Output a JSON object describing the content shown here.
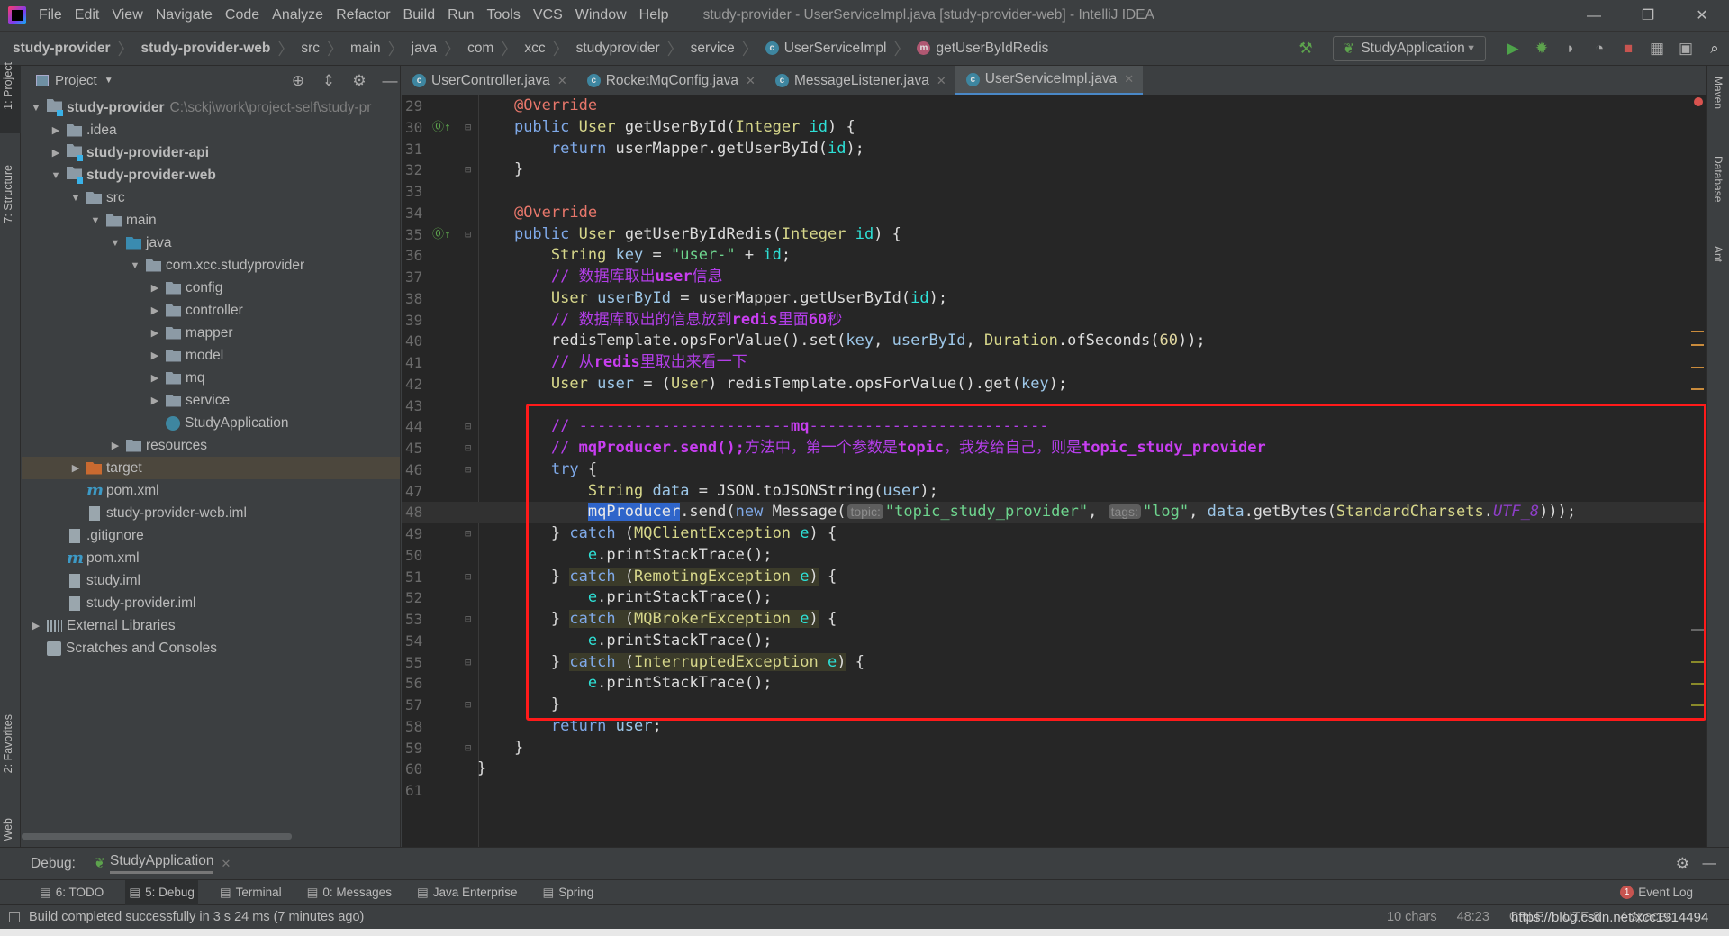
{
  "window": {
    "title": "study-provider - UserServiceImpl.java [study-provider-web] - IntelliJ IDEA",
    "menu": [
      "File",
      "Edit",
      "View",
      "Navigate",
      "Code",
      "Analyze",
      "Refactor",
      "Build",
      "Run",
      "Tools",
      "VCS",
      "Window",
      "Help"
    ],
    "controls": {
      "minimize": "—",
      "restore": "❐",
      "close": "✕"
    }
  },
  "breadcrumb": [
    {
      "label": "study-provider",
      "bold": true
    },
    {
      "label": "study-provider-web",
      "bold": true
    },
    {
      "label": "src"
    },
    {
      "label": "main"
    },
    {
      "label": "java"
    },
    {
      "label": "com"
    },
    {
      "label": "xcc"
    },
    {
      "label": "studyprovider"
    },
    {
      "label": "service"
    },
    {
      "label": "UserServiceImpl",
      "icon": "class-icon",
      "icon_text": "c"
    },
    {
      "label": "getUserByIdRedis",
      "icon": "method-icon",
      "icon_text": "m"
    }
  ],
  "run_toolbar": {
    "config": "StudyApplication"
  },
  "left_stripe": [
    "1: Project",
    "7: Structure",
    "2: Favorites",
    "Web"
  ],
  "right_stripe": [
    "Maven",
    "Database",
    "Ant"
  ],
  "project_panel": {
    "title": "Project",
    "tree": [
      {
        "label": "study-provider",
        "depth": 0,
        "arrow": "open",
        "icon": "module",
        "bold": true,
        "path": "C:\\sckj\\work\\project-self\\study-pr"
      },
      {
        "label": ".idea",
        "depth": 1,
        "arrow": "closed",
        "icon": "folder"
      },
      {
        "label": "study-provider-api",
        "depth": 1,
        "arrow": "closed",
        "icon": "module",
        "bold": true
      },
      {
        "label": "study-provider-web",
        "depth": 1,
        "arrow": "open",
        "icon": "module",
        "bold": true
      },
      {
        "label": "src",
        "depth": 2,
        "arrow": "open",
        "icon": "folder"
      },
      {
        "label": "main",
        "depth": 3,
        "arrow": "open",
        "icon": "folder"
      },
      {
        "label": "java",
        "depth": 4,
        "arrow": "open",
        "icon": "src"
      },
      {
        "label": "com.xcc.studyprovider",
        "depth": 5,
        "arrow": "open",
        "icon": "folder"
      },
      {
        "label": "config",
        "depth": 6,
        "arrow": "closed",
        "icon": "folder"
      },
      {
        "label": "controller",
        "depth": 6,
        "arrow": "closed",
        "icon": "folder"
      },
      {
        "label": "mapper",
        "depth": 6,
        "arrow": "closed",
        "icon": "folder"
      },
      {
        "label": "model",
        "depth": 6,
        "arrow": "closed",
        "icon": "folder"
      },
      {
        "label": "mq",
        "depth": 6,
        "arrow": "closed",
        "icon": "folder"
      },
      {
        "label": "service",
        "depth": 6,
        "arrow": "closed",
        "icon": "folder"
      },
      {
        "label": "StudyApplication",
        "depth": 6,
        "arrow": "none",
        "icon": "app"
      },
      {
        "label": "resources",
        "depth": 4,
        "arrow": "closed",
        "icon": "folder"
      },
      {
        "label": "target",
        "depth": 2,
        "arrow": "closed",
        "icon": "target",
        "selected": true
      },
      {
        "label": "pom.xml",
        "depth": 2,
        "arrow": "none",
        "icon": "maven"
      },
      {
        "label": "study-provider-web.iml",
        "depth": 2,
        "arrow": "none",
        "icon": "file"
      },
      {
        "label": ".gitignore",
        "depth": 1,
        "arrow": "none",
        "icon": "file"
      },
      {
        "label": "pom.xml",
        "depth": 1,
        "arrow": "none",
        "icon": "maven"
      },
      {
        "label": "study.iml",
        "depth": 1,
        "arrow": "none",
        "icon": "file"
      },
      {
        "label": "study-provider.iml",
        "depth": 1,
        "arrow": "none",
        "icon": "file"
      },
      {
        "label": "External Libraries",
        "depth": 0,
        "arrow": "closed",
        "icon": "lib"
      },
      {
        "label": "Scratches and Consoles",
        "depth": 0,
        "arrow": "none",
        "icon": "scratch"
      }
    ]
  },
  "tabs": [
    {
      "label": "UserController.java"
    },
    {
      "label": "RocketMqConfig.java"
    },
    {
      "label": "MessageListener.java"
    },
    {
      "label": "UserServiceImpl.java",
      "active": true
    }
  ],
  "editor": {
    "current_line": 48,
    "lines": [
      {
        "n": 29,
        "indent": 4,
        "t": [
          [
            "@Override",
            "ann"
          ]
        ]
      },
      {
        "n": 30,
        "indent": 4,
        "mark": "impl",
        "fold": "open",
        "t": [
          [
            "public",
            "kw"
          ],
          [
            " "
          ],
          [
            "User",
            "type"
          ],
          [
            " getUserById("
          ],
          [
            "Integer",
            "type"
          ],
          [
            " "
          ],
          [
            "id",
            "param"
          ],
          [
            ") {"
          ]
        ]
      },
      {
        "n": 31,
        "indent": 8,
        "t": [
          [
            "return",
            "kw"
          ],
          [
            " userMapper.getUserById("
          ],
          [
            "id",
            "param"
          ],
          [
            ");"
          ]
        ]
      },
      {
        "n": 32,
        "indent": 4,
        "fold": "close",
        "t": [
          [
            "}"
          ]
        ]
      },
      {
        "n": 33,
        "indent": 0,
        "t": []
      },
      {
        "n": 34,
        "indent": 4,
        "t": [
          [
            "@Override",
            "ann"
          ]
        ]
      },
      {
        "n": 35,
        "indent": 4,
        "mark": "impl",
        "fold": "open",
        "t": [
          [
            "public",
            "kw"
          ],
          [
            " "
          ],
          [
            "User",
            "type"
          ],
          [
            " getUserByIdRedis("
          ],
          [
            "Integer",
            "type"
          ],
          [
            " "
          ],
          [
            "id",
            "param"
          ],
          [
            ") {"
          ]
        ]
      },
      {
        "n": 36,
        "indent": 8,
        "t": [
          [
            "String",
            "type"
          ],
          [
            " "
          ],
          [
            "key",
            "var"
          ],
          [
            " = "
          ],
          [
            "\"user-\"",
            "str"
          ],
          [
            " + "
          ],
          [
            "id",
            "param"
          ],
          [
            ";"
          ]
        ]
      },
      {
        "n": 37,
        "indent": 8,
        "t": [
          [
            "// 数据库取出",
            "cm"
          ],
          [
            "user",
            "cmb"
          ],
          [
            "信息",
            "cm"
          ]
        ]
      },
      {
        "n": 38,
        "indent": 8,
        "t": [
          [
            "User",
            "type"
          ],
          [
            " "
          ],
          [
            "userById",
            "var"
          ],
          [
            " = userMapper.getUserById("
          ],
          [
            "id",
            "param"
          ],
          [
            ");"
          ]
        ]
      },
      {
        "n": 39,
        "indent": 8,
        "t": [
          [
            "// 数据库取出的信息放到",
            "cm"
          ],
          [
            "redis",
            "cmb"
          ],
          [
            "里面",
            "cm"
          ],
          [
            "60",
            "cmb"
          ],
          [
            "秒",
            "cm"
          ]
        ]
      },
      {
        "n": 40,
        "indent": 8,
        "t": [
          [
            "redisTemplate.opsForValue().set("
          ],
          [
            "key",
            "var"
          ],
          [
            ", "
          ],
          [
            "userById",
            "var"
          ],
          [
            ", "
          ],
          [
            "Duration",
            "type"
          ],
          [
            ".ofSeconds("
          ],
          [
            "60",
            "num"
          ],
          [
            "));"
          ]
        ]
      },
      {
        "n": 41,
        "indent": 8,
        "t": [
          [
            "// 从",
            "cm"
          ],
          [
            "redis",
            "cmb"
          ],
          [
            "里取出来看一下",
            "cm"
          ]
        ]
      },
      {
        "n": 42,
        "indent": 8,
        "t": [
          [
            "User",
            "type"
          ],
          [
            " "
          ],
          [
            "user",
            "var"
          ],
          [
            " = ("
          ],
          [
            "User",
            "type"
          ],
          [
            ") redisTemplate.opsForValue().get("
          ],
          [
            "key",
            "var"
          ],
          [
            ");"
          ]
        ]
      },
      {
        "n": 43,
        "indent": 0,
        "t": []
      },
      {
        "n": 44,
        "indent": 8,
        "fold": "open",
        "t": [
          [
            "// -----------------------",
            "cm"
          ],
          [
            "mq",
            "cmb"
          ],
          [
            "--------------------------",
            "cm"
          ]
        ]
      },
      {
        "n": 45,
        "indent": 8,
        "fold": "close",
        "t": [
          [
            "// ",
            "cm"
          ],
          [
            "mqProducer.send();",
            "cmb"
          ],
          [
            "方法中，第一个参数是",
            "cm"
          ],
          [
            "topic",
            "cmb"
          ],
          [
            "，我发给自己，则是",
            "cm"
          ],
          [
            "topic_study_provider",
            "cmb"
          ]
        ]
      },
      {
        "n": 46,
        "indent": 8,
        "fold": "open",
        "t": [
          [
            "try",
            "kw"
          ],
          [
            " {"
          ]
        ]
      },
      {
        "n": 47,
        "indent": 12,
        "t": [
          [
            "String",
            "type"
          ],
          [
            " "
          ],
          [
            "data",
            "var"
          ],
          [
            " = JSON.toJSONString("
          ],
          [
            "user",
            "var"
          ],
          [
            ");"
          ]
        ]
      },
      {
        "n": 48,
        "indent": 12,
        "t": [
          [
            "mqProducer",
            "sel"
          ],
          [
            ".send("
          ],
          [
            "new",
            "kw"
          ],
          [
            " Message("
          ],
          [
            "topic:",
            "hint"
          ],
          [
            "\"topic_study_provider\"",
            "str"
          ],
          [
            ", "
          ],
          [
            "tags:",
            "hint"
          ],
          [
            "\"log\"",
            "str"
          ],
          [
            ", "
          ],
          [
            "data",
            "var"
          ],
          [
            ".getBytes("
          ],
          [
            "StandardCharsets",
            "type"
          ],
          [
            "."
          ],
          [
            "UTF_8",
            "const"
          ],
          [
            ")));"
          ]
        ]
      },
      {
        "n": 49,
        "indent": 8,
        "fold": "open",
        "t": [
          [
            "} "
          ],
          [
            "catch",
            "kw"
          ],
          [
            " ("
          ],
          [
            "MQClientException",
            "type"
          ],
          [
            " "
          ],
          [
            "e",
            "param"
          ],
          [
            ") {"
          ]
        ]
      },
      {
        "n": 50,
        "indent": 12,
        "t": [
          [
            "e",
            "param"
          ],
          [
            ".printStackTrace();"
          ]
        ]
      },
      {
        "n": 51,
        "indent": 8,
        "fold": "close",
        "t": [
          [
            "} "
          ],
          [
            "catch",
            "kw hl"
          ],
          [
            " (",
            "hl"
          ],
          [
            "RemotingException",
            "type hl"
          ],
          [
            " ",
            "hl"
          ],
          [
            "e",
            "param hl"
          ],
          [
            ")",
            "hl"
          ],
          [
            " {"
          ]
        ]
      },
      {
        "n": 52,
        "indent": 12,
        "t": [
          [
            "e",
            "param"
          ],
          [
            ".printStackTrace();"
          ]
        ]
      },
      {
        "n": 53,
        "indent": 8,
        "fold": "close",
        "t": [
          [
            "} "
          ],
          [
            "catch",
            "kw hl"
          ],
          [
            " (",
            "hl"
          ],
          [
            "MQBrokerException",
            "type hl"
          ],
          [
            " ",
            "hl"
          ],
          [
            "e",
            "param hl"
          ],
          [
            ")",
            "hl"
          ],
          [
            " {"
          ]
        ]
      },
      {
        "n": 54,
        "indent": 12,
        "t": [
          [
            "e",
            "param"
          ],
          [
            ".printStackTrace();"
          ]
        ]
      },
      {
        "n": 55,
        "indent": 8,
        "fold": "close",
        "t": [
          [
            "} "
          ],
          [
            "catch",
            "kw hl"
          ],
          [
            " (",
            "hl"
          ],
          [
            "InterruptedException",
            "type hl"
          ],
          [
            " ",
            "hl"
          ],
          [
            "e",
            "param hl"
          ],
          [
            ")",
            "hl"
          ],
          [
            " {"
          ]
        ]
      },
      {
        "n": 56,
        "indent": 12,
        "t": [
          [
            "e",
            "param"
          ],
          [
            ".printStackTrace();"
          ]
        ]
      },
      {
        "n": 57,
        "indent": 8,
        "fold": "close",
        "t": [
          [
            "}"
          ]
        ]
      },
      {
        "n": 58,
        "indent": 8,
        "t": [
          [
            "return",
            "kw"
          ],
          [
            " "
          ],
          [
            "user",
            "var"
          ],
          [
            ";"
          ]
        ]
      },
      {
        "n": 59,
        "indent": 4,
        "fold": "close",
        "t": [
          [
            "}"
          ]
        ]
      },
      {
        "n": 60,
        "indent": 0,
        "t": [
          [
            "}"
          ]
        ]
      },
      {
        "n": 61,
        "indent": 0,
        "t": []
      }
    ]
  },
  "debug_bar": {
    "label": "Debug:",
    "session": "StudyApplication"
  },
  "tool_windows": [
    {
      "label": "6: TODO",
      "icon": "list-icon"
    },
    {
      "label": "5: Debug",
      "icon": "bug-icon",
      "active": true
    },
    {
      "label": "Terminal",
      "icon": "terminal-icon"
    },
    {
      "label": "0: Messages",
      "icon": "messages-icon"
    },
    {
      "label": "Java Enterprise",
      "icon": "java-enterprise-icon"
    },
    {
      "label": "Spring",
      "icon": "spring-icon"
    }
  ],
  "event_log": {
    "label": "Event Log",
    "badge": "1"
  },
  "status": {
    "message": "Build completed successfully in 3 s 24 ms (7 minutes ago)",
    "selection": "10 chars",
    "position": "48:23",
    "line_sep": "CRLF",
    "encoding": "UTF-8",
    "indent": "4 spaces",
    "watermark": "https://blog.csdn.net/xcc1914494"
  },
  "colors": {
    "accent": "#4a88c7",
    "highlight_box": "#ff1a1a",
    "editor_bg": "#262626"
  }
}
